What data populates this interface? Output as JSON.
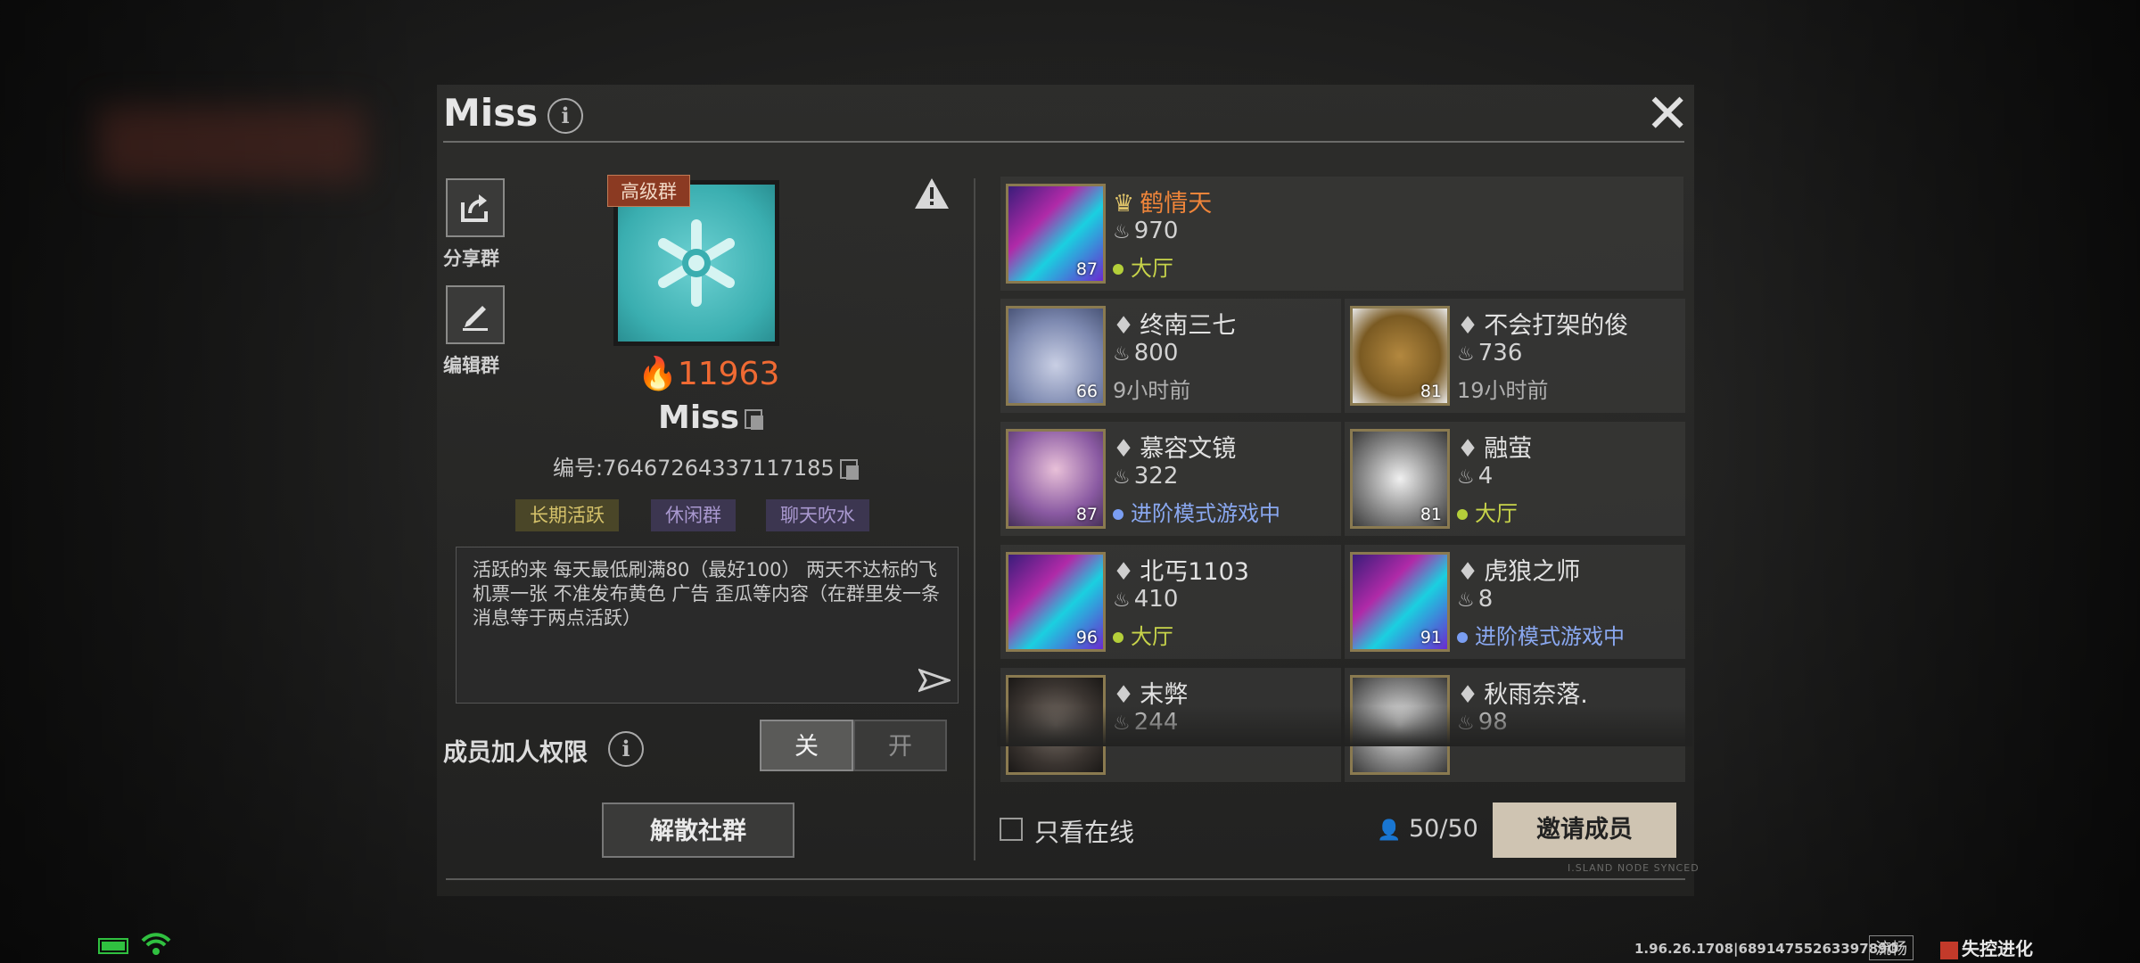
{
  "header": {
    "title": "Miss",
    "info_icon": "i",
    "close_icon": "✕"
  },
  "actions": {
    "share_label": "分享群",
    "edit_label": "编辑群"
  },
  "group": {
    "badge": "高级群",
    "score": "11963",
    "name": "Miss",
    "id_text": "编号:76467264337117185",
    "tags": [
      "长期活跃",
      "休闲群",
      "聊天吹水"
    ],
    "description": "活跃的来 每天最低刷满80（最好100） 两天不达标的飞机票一张 不准发布黄色 广告 歪瓜等内容（在群里发一条消息等于两点活跃）"
  },
  "permission": {
    "label": "成员加人权限",
    "off_label": "关",
    "on_label": "开",
    "selected": "关"
  },
  "disband_label": "解散社群",
  "members": [
    {
      "name": "鹤情天",
      "score": "970",
      "status": "大厅",
      "status_type": "lobby",
      "level": "87",
      "role": "owner",
      "avatar": "av-neon"
    },
    {
      "name": "终南三七",
      "score": "800",
      "status": "9小时前",
      "status_type": "time",
      "level": "66",
      "role": "member",
      "avatar": "av-cat"
    },
    {
      "name": "不会打架的俊",
      "score": "736",
      "status": "19小时前",
      "status_type": "time",
      "level": "81",
      "role": "member",
      "avatar": "av-bear"
    },
    {
      "name": "慕容文镜",
      "score": "322",
      "status": "进阶模式游戏中",
      "status_type": "game",
      "level": "87",
      "role": "member",
      "avatar": "av-anime"
    },
    {
      "name": "融萤",
      "score": "4",
      "status": "大厅",
      "status_type": "lobby",
      "level": "81",
      "role": "member",
      "avatar": "av-girl"
    },
    {
      "name": "北丐1103",
      "score": "410",
      "status": "大厅",
      "status_type": "lobby",
      "level": "96",
      "role": "member",
      "avatar": "av-neon"
    },
    {
      "name": "虎狼之师",
      "score": "8",
      "status": "进阶模式游戏中",
      "status_type": "game",
      "level": "91",
      "role": "member",
      "avatar": "av-neon"
    },
    {
      "name": "末弊",
      "score": "244",
      "status": "",
      "status_type": "time",
      "level": "",
      "role": "member",
      "avatar": "av-dark"
    },
    {
      "name": "秋雨奈落.",
      "score": "98",
      "status": "",
      "status_type": "time",
      "level": "",
      "role": "member",
      "avatar": "av-girl"
    }
  ],
  "footer": {
    "online_only_label": "只看在线",
    "online_only_checked": false,
    "member_count": "50/50",
    "invite_label": "邀请成员",
    "sync_text": "I.SLAND NODE SYNCED"
  },
  "statusbar": {
    "version": "1.96.26.1708|6891475526339789O",
    "fluency": "流畅",
    "logo_text": "失控进化"
  },
  "colors": {
    "accent_orange": "#f06a33",
    "invite_bg": "#cfc4b2",
    "lobby": "#c8d44a",
    "in_game": "#8aa8f0"
  }
}
